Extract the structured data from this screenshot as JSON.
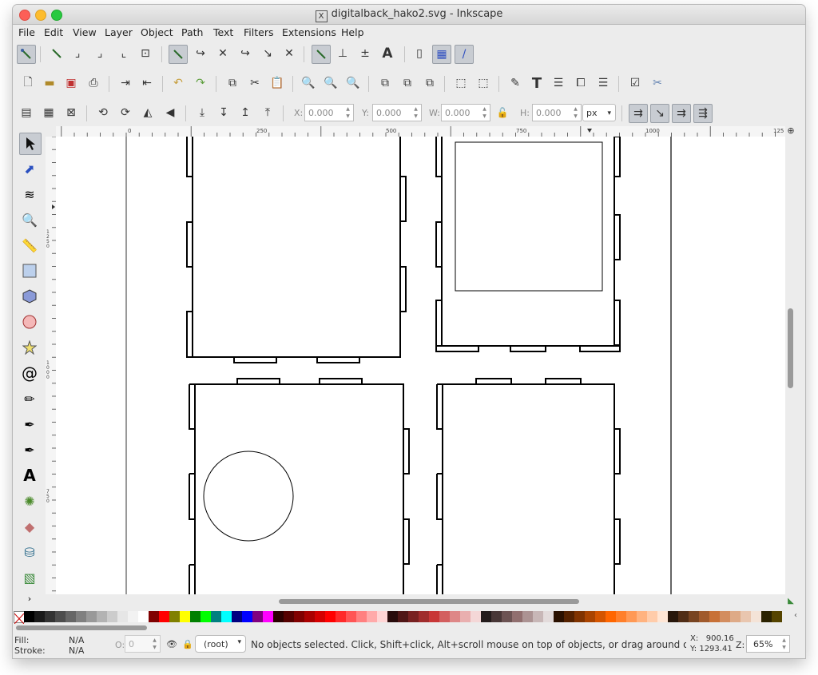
{
  "window": {
    "title": "digitalback_hako2.svg - Inkscape"
  },
  "menu": [
    "File",
    "Edit",
    "View",
    "Layer",
    "Object",
    "Path",
    "Text",
    "Filters",
    "Extensions",
    "Help"
  ],
  "toolbar3": {
    "x_label": "X:",
    "x_value": "0.000",
    "y_label": "Y:",
    "y_value": "0.000",
    "w_label": "W:",
    "w_value": "0.000",
    "h_label": "H:",
    "h_value": "0.000",
    "unit": "px"
  },
  "ruler": {
    "h_ticks": [
      "0",
      "250",
      "500",
      "750",
      "1000",
      "125"
    ],
    "v_ticks": [
      "1\n2\n5\n0",
      "1\n0\n0\n0",
      "7\n5\n0"
    ]
  },
  "status": {
    "fill_label": "Fill:",
    "fill_value": "N/A",
    "stroke_label": "Stroke:",
    "stroke_value": "N/A",
    "opacity_label": "O:",
    "opacity_value": "0",
    "layer": "(root)",
    "message": "No objects selected. Click, Shift+click, Alt+scroll mouse on top of objects, or drag around ob",
    "x_readout": "X:   900.16",
    "y_readout": "Y: 1293.41",
    "zoom_label": "Z:",
    "zoom_value": "65%"
  },
  "colors": {
    "palette": [
      "#000000",
      "#1a1a1a",
      "#333333",
      "#4d4d4d",
      "#666666",
      "#808080",
      "#999999",
      "#b3b3b3",
      "#cccccc",
      "#e6e6e6",
      "#f2f2f2",
      "#ffffff",
      "#800000",
      "#ff0000",
      "#808000",
      "#ffff00",
      "#008000",
      "#00ff00",
      "#008080",
      "#00ffff",
      "#000080",
      "#0000ff",
      "#800080",
      "#ff00ff",
      "#2b0000",
      "#550000",
      "#800000",
      "#aa0000",
      "#d40000",
      "#ff0000",
      "#ff2a2a",
      "#ff5555",
      "#ff8080",
      "#ffaaaa",
      "#ffd5d5",
      "#280b0b",
      "#501616",
      "#782121",
      "#a02c2c",
      "#c83737",
      "#d35f5f",
      "#de8787",
      "#e9afaf",
      "#f4d7d7",
      "#241c1c",
      "#483737",
      "#6c5353",
      "#916f6f",
      "#ac9393",
      "#c8b7b7",
      "#e3dbdb",
      "#2b1100",
      "#552200",
      "#803300",
      "#aa4400",
      "#d45500",
      "#ff6600",
      "#ff7f2a",
      "#ff9955",
      "#ffb380",
      "#ffccaa",
      "#ffe6d5",
      "#28170b",
      "#502d16",
      "#784421",
      "#a05a2c",
      "#c87137",
      "#d38d5f",
      "#deaa87",
      "#e9c6af",
      "#f4e3d7",
      "#2b2200",
      "#554400"
    ]
  }
}
